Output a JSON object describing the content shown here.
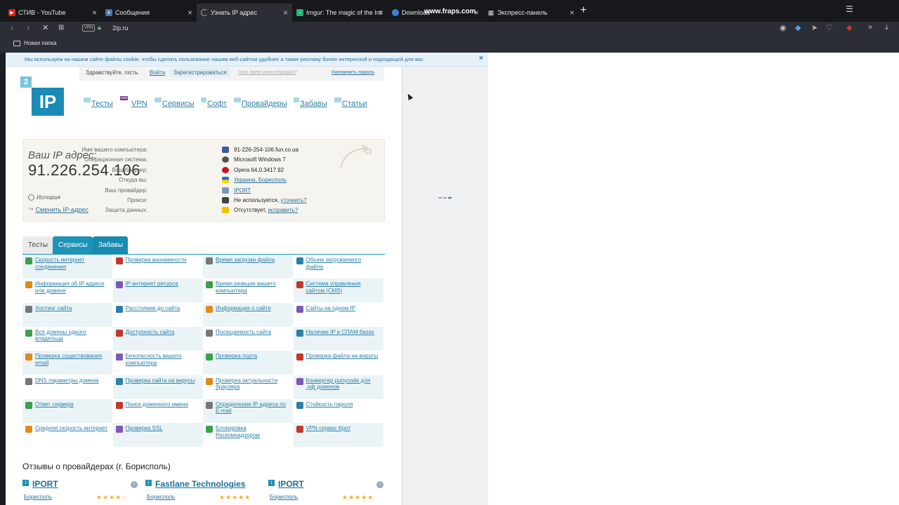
{
  "browser": {
    "tabs": [
      {
        "label": "СТИВ - YouTube",
        "favicon_color": "#e62117",
        "favicon": "youtube-icon",
        "active": false
      },
      {
        "label": "Сообщения",
        "favicon_color": "#4a76a8",
        "favicon": "vk-icon",
        "active": false
      },
      {
        "label": "Узнать IP адрес",
        "favicon_color": "#888888",
        "favicon": "loading-icon",
        "active": true
      },
      {
        "label": "Imgur: The magic of the Int",
        "favicon_color": "#1bb76e",
        "favicon": "imgur-icon",
        "active": false
      },
      {
        "label": "Download",
        "favicon_color": "#3b7fd4",
        "favicon": "globe-icon",
        "active": false
      },
      {
        "label": "Экспресс-панель",
        "favicon_color": "#cccccc",
        "favicon": "grid-icon",
        "active": false
      }
    ],
    "watermark": "www.fraps.com",
    "vpn_label": "VPN",
    "url": "2ip.ru",
    "bookmark": "Новая папка"
  },
  "cookie": {
    "text": "Мы используем на нашем сайте файлы cookie, чтобы сделать пользование нашим веб-сайтом удобнее а также рекламу более интересной и подходящей для вас.",
    "close": "×"
  },
  "userbar": {
    "greeting": "Здравствуйте, гость.",
    "login": "Войти",
    "register": "Зарегистрироваться",
    "why": "Что дает регистрация?",
    "remind": "Напомнить пароль"
  },
  "logo": {
    "two": "2",
    "ip": "IP"
  },
  "nav": {
    "items": [
      "Тесты",
      "VPN",
      "Сервисы",
      "Софт",
      "Провайдеры",
      "Забавы",
      "Статьи"
    ],
    "new_badge": "new"
  },
  "ipinfo": {
    "title": "Ваш IP адрес:",
    "ip": "91.226.254.106",
    "history": "История",
    "change": "Сменить IP-адрес",
    "rows": [
      {
        "label": "Имя вашего компьютера:",
        "value": "91-226-254-106.fun.co.ua",
        "link": "",
        "icon_color": "#3a5a9a"
      },
      {
        "label": "Операционная система:",
        "value": "Microsoft Windows 7",
        "link": "",
        "icon_color": "#555555"
      },
      {
        "label": "Ваш браузер:",
        "value": "Opera 64.0.3417.92",
        "link": "",
        "icon_color": "#cc1122"
      },
      {
        "label": "Откуда вы:",
        "value": "",
        "link": "Украина, Борисполь",
        "icon_color": "#ffd500"
      },
      {
        "label": "Ваш провайдер:",
        "value": "",
        "link": "IPORT",
        "icon_color": "#7a9ab8"
      },
      {
        "label": "Прокси:",
        "value": "Не используется,",
        "link": "уточнить?",
        "icon_color": "#444444"
      },
      {
        "label": "Защита данных:",
        "value": "Отсутствует,",
        "link": "исправить?",
        "icon_color": "#f2c200"
      }
    ]
  },
  "content_tabs": [
    "Тесты",
    "Сервисы",
    "Забавы"
  ],
  "services": [
    [
      "Скорость интернет соединения",
      "Проверка анонимности",
      "Время загрузки файла",
      "Объем загружаемого файла"
    ],
    [
      "Информация об IP адресе или домене",
      "IP интернет ресурса",
      "Время реакции вашего компьютера",
      "Система управления сайтом (CMS)"
    ],
    [
      "Хостинг сайта",
      "Расстояние до сайта",
      "Информация о сайте",
      "Сайты на одном IP"
    ],
    [
      "Все домены одного владельца",
      "Доступность сайта",
      "Посещаемость сайта",
      "Наличие IP в СПАМ базах"
    ],
    [
      "Проверка существования email",
      "Безопасность вашего компьютера",
      "Проверка порта",
      "Проверка файла на вирусы"
    ],
    [
      "DNS параметры домена",
      "Проверка сайта на вирусы",
      "Проверка актуальности браузера",
      "Конвертер punycode для .рф доменов"
    ],
    [
      "Ответ сервера",
      "Поиск доменного имени",
      "Определение IP адреса по E-mail",
      "Стойкость пароля"
    ],
    [
      "Средняя скорость интернет",
      "Проверка SSL",
      "Блокировка Роскомнадзором",
      "VPN сервис Крот"
    ]
  ],
  "service_icon_colors": [
    "#3aa04a",
    "#c0392b",
    "#777777",
    "#2b7fa8",
    "#e08a1e",
    "#7a5ab8"
  ],
  "reviews": {
    "title": "Отзывы о провайдерах (г. Борисполь)",
    "items": [
      {
        "name": "IPORT",
        "city": "Борисполь",
        "stars": "★★★★☆"
      },
      {
        "name": "Fastlane Technologies",
        "city": "Борисполь",
        "stars": "★★★★★"
      },
      {
        "name": "IPORT",
        "city": "Борисполь",
        "stars": "★★★★★"
      }
    ]
  }
}
